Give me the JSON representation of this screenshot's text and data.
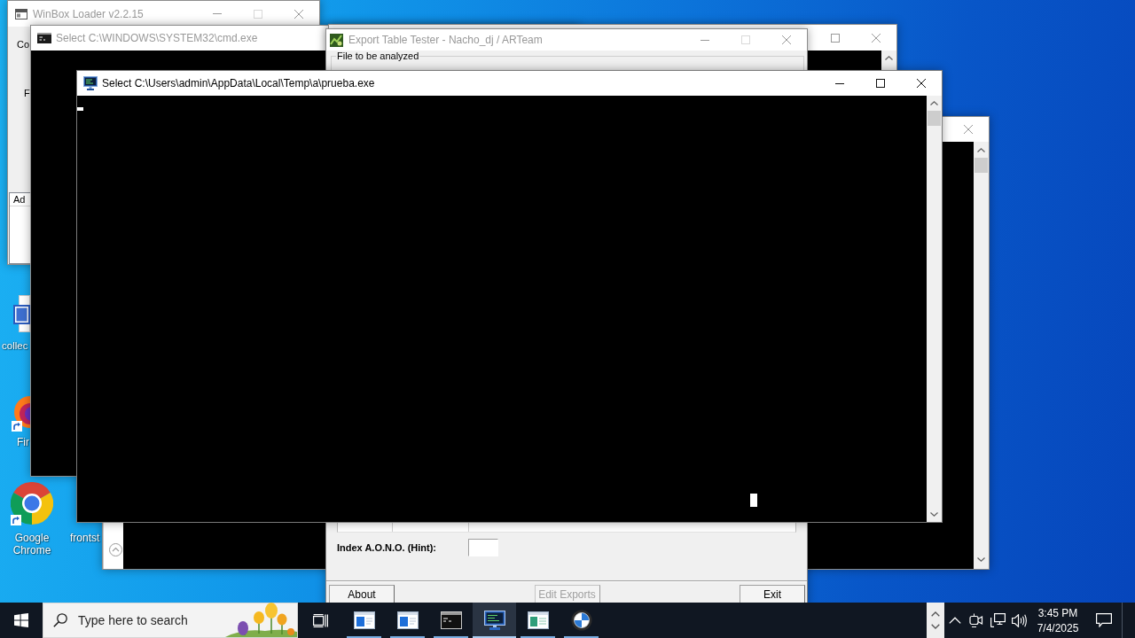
{
  "desktop_icons": [
    {
      "kind": "document",
      "label": "collec"
    },
    {
      "kind": "round-app",
      "label": "Fir"
    },
    {
      "kind": "segmented-circle",
      "label": "Google Chrome"
    },
    {
      "kind": "label-only",
      "label": "frontst"
    }
  ],
  "winbox_window": {
    "title": "WinBox Loader v2.2.15",
    "active": false,
    "maximize_disabled": true,
    "labels": [
      "Co",
      "F"
    ],
    "list_header": "Ad"
  },
  "cmd_window": {
    "title": "Select C:\\WINDOWS\\SYSTEM32\\cmd.exe",
    "active": false
  },
  "export_window": {
    "title": "Export Table Tester - Nacho_dj / ARTeam",
    "active": false,
    "maximize_disabled": true,
    "group_label": "File to be analyzed",
    "hint_label": "Index A.O.N.O. (Hint):",
    "buttons": [
      {
        "label": "About",
        "disabled": false
      },
      {
        "label": "Edit Exports",
        "disabled": true
      },
      {
        "label": "Exit",
        "disabled": false
      }
    ]
  },
  "prueba_window": {
    "title": "Select C:\\Users\\admin\\AppData\\Local\\Temp\\a\\prueba.exe",
    "active": true
  },
  "taskbar": {
    "search": {
      "placeholder": "Type here to search"
    },
    "apps": [
      {
        "kind": "window",
        "selected": false,
        "running": true
      },
      {
        "kind": "window",
        "selected": false,
        "running": true
      },
      {
        "kind": "console",
        "selected": false,
        "running": true
      },
      {
        "kind": "monitor",
        "selected": true,
        "running": true
      },
      {
        "kind": "sheet",
        "selected": false,
        "running": true
      },
      {
        "kind": "roundel",
        "selected": false,
        "running": true
      }
    ],
    "clock": {
      "time": "3:45 PM",
      "date": "7/4/2025"
    }
  }
}
